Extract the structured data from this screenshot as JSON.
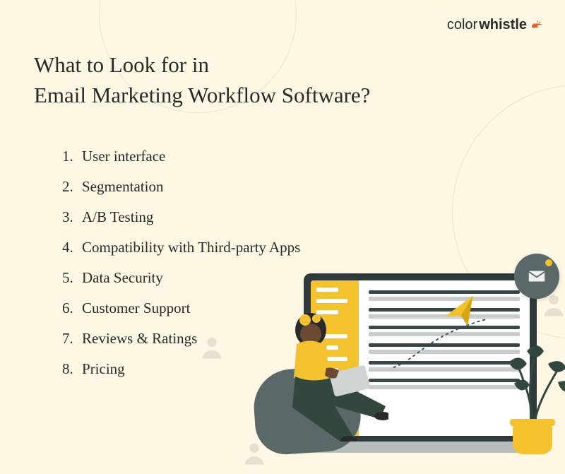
{
  "logo": {
    "part1": "color",
    "part2": "whistle"
  },
  "title": {
    "line1": "What to Look for in",
    "line2": "Email Marketing Workflow Software?"
  },
  "list_items": [
    "User interface",
    "Segmentation",
    "A/B Testing",
    "Compatibility with Third-party Apps",
    "Data Security",
    "Customer Support",
    "Reviews & Ratings",
    "Pricing"
  ]
}
